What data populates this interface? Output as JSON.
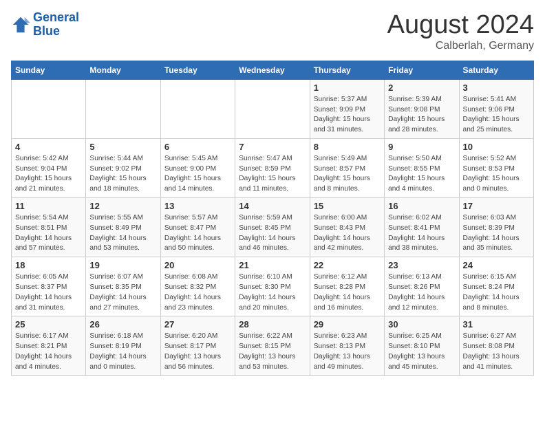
{
  "header": {
    "logo_line1": "General",
    "logo_line2": "Blue",
    "title": "August 2024",
    "subtitle": "Calberlah, Germany"
  },
  "weekdays": [
    "Sunday",
    "Monday",
    "Tuesday",
    "Wednesday",
    "Thursday",
    "Friday",
    "Saturday"
  ],
  "weeks": [
    [
      {
        "day": "",
        "info": ""
      },
      {
        "day": "",
        "info": ""
      },
      {
        "day": "",
        "info": ""
      },
      {
        "day": "",
        "info": ""
      },
      {
        "day": "1",
        "info": "Sunrise: 5:37 AM\nSunset: 9:09 PM\nDaylight: 15 hours\nand 31 minutes."
      },
      {
        "day": "2",
        "info": "Sunrise: 5:39 AM\nSunset: 9:08 PM\nDaylight: 15 hours\nand 28 minutes."
      },
      {
        "day": "3",
        "info": "Sunrise: 5:41 AM\nSunset: 9:06 PM\nDaylight: 15 hours\nand 25 minutes."
      }
    ],
    [
      {
        "day": "4",
        "info": "Sunrise: 5:42 AM\nSunset: 9:04 PM\nDaylight: 15 hours\nand 21 minutes."
      },
      {
        "day": "5",
        "info": "Sunrise: 5:44 AM\nSunset: 9:02 PM\nDaylight: 15 hours\nand 18 minutes."
      },
      {
        "day": "6",
        "info": "Sunrise: 5:45 AM\nSunset: 9:00 PM\nDaylight: 15 hours\nand 14 minutes."
      },
      {
        "day": "7",
        "info": "Sunrise: 5:47 AM\nSunset: 8:59 PM\nDaylight: 15 hours\nand 11 minutes."
      },
      {
        "day": "8",
        "info": "Sunrise: 5:49 AM\nSunset: 8:57 PM\nDaylight: 15 hours\nand 8 minutes."
      },
      {
        "day": "9",
        "info": "Sunrise: 5:50 AM\nSunset: 8:55 PM\nDaylight: 15 hours\nand 4 minutes."
      },
      {
        "day": "10",
        "info": "Sunrise: 5:52 AM\nSunset: 8:53 PM\nDaylight: 15 hours\nand 0 minutes."
      }
    ],
    [
      {
        "day": "11",
        "info": "Sunrise: 5:54 AM\nSunset: 8:51 PM\nDaylight: 14 hours\nand 57 minutes."
      },
      {
        "day": "12",
        "info": "Sunrise: 5:55 AM\nSunset: 8:49 PM\nDaylight: 14 hours\nand 53 minutes."
      },
      {
        "day": "13",
        "info": "Sunrise: 5:57 AM\nSunset: 8:47 PM\nDaylight: 14 hours\nand 50 minutes."
      },
      {
        "day": "14",
        "info": "Sunrise: 5:59 AM\nSunset: 8:45 PM\nDaylight: 14 hours\nand 46 minutes."
      },
      {
        "day": "15",
        "info": "Sunrise: 6:00 AM\nSunset: 8:43 PM\nDaylight: 14 hours\nand 42 minutes."
      },
      {
        "day": "16",
        "info": "Sunrise: 6:02 AM\nSunset: 8:41 PM\nDaylight: 14 hours\nand 38 minutes."
      },
      {
        "day": "17",
        "info": "Sunrise: 6:03 AM\nSunset: 8:39 PM\nDaylight: 14 hours\nand 35 minutes."
      }
    ],
    [
      {
        "day": "18",
        "info": "Sunrise: 6:05 AM\nSunset: 8:37 PM\nDaylight: 14 hours\nand 31 minutes."
      },
      {
        "day": "19",
        "info": "Sunrise: 6:07 AM\nSunset: 8:35 PM\nDaylight: 14 hours\nand 27 minutes."
      },
      {
        "day": "20",
        "info": "Sunrise: 6:08 AM\nSunset: 8:32 PM\nDaylight: 14 hours\nand 23 minutes."
      },
      {
        "day": "21",
        "info": "Sunrise: 6:10 AM\nSunset: 8:30 PM\nDaylight: 14 hours\nand 20 minutes."
      },
      {
        "day": "22",
        "info": "Sunrise: 6:12 AM\nSunset: 8:28 PM\nDaylight: 14 hours\nand 16 minutes."
      },
      {
        "day": "23",
        "info": "Sunrise: 6:13 AM\nSunset: 8:26 PM\nDaylight: 14 hours\nand 12 minutes."
      },
      {
        "day": "24",
        "info": "Sunrise: 6:15 AM\nSunset: 8:24 PM\nDaylight: 14 hours\nand 8 minutes."
      }
    ],
    [
      {
        "day": "25",
        "info": "Sunrise: 6:17 AM\nSunset: 8:21 PM\nDaylight: 14 hours\nand 4 minutes."
      },
      {
        "day": "26",
        "info": "Sunrise: 6:18 AM\nSunset: 8:19 PM\nDaylight: 14 hours\nand 0 minutes."
      },
      {
        "day": "27",
        "info": "Sunrise: 6:20 AM\nSunset: 8:17 PM\nDaylight: 13 hours\nand 56 minutes."
      },
      {
        "day": "28",
        "info": "Sunrise: 6:22 AM\nSunset: 8:15 PM\nDaylight: 13 hours\nand 53 minutes."
      },
      {
        "day": "29",
        "info": "Sunrise: 6:23 AM\nSunset: 8:13 PM\nDaylight: 13 hours\nand 49 minutes."
      },
      {
        "day": "30",
        "info": "Sunrise: 6:25 AM\nSunset: 8:10 PM\nDaylight: 13 hours\nand 45 minutes."
      },
      {
        "day": "31",
        "info": "Sunrise: 6:27 AM\nSunset: 8:08 PM\nDaylight: 13 hours\nand 41 minutes."
      }
    ]
  ]
}
